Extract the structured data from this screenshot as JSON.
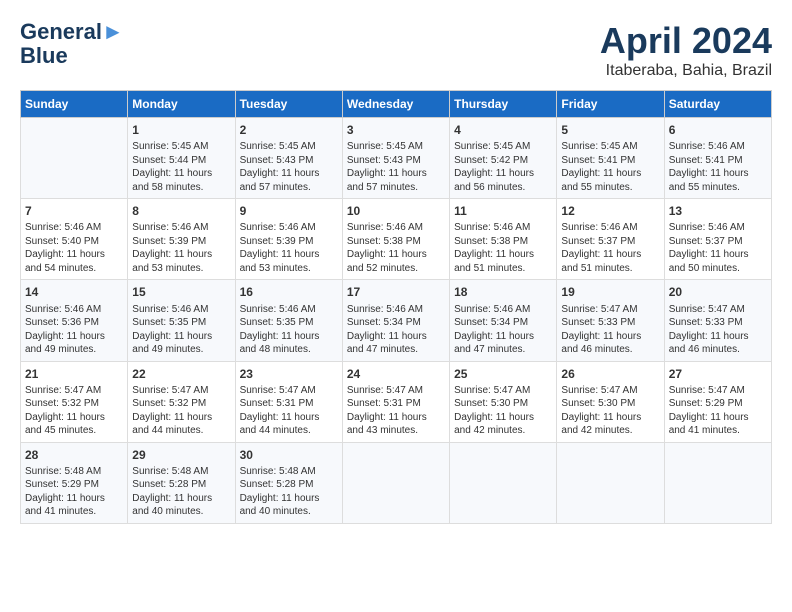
{
  "header": {
    "logo_line1": "General",
    "logo_line2": "Blue",
    "month_title": "April 2024",
    "location": "Itaberaba, Bahia, Brazil"
  },
  "calendar": {
    "days_of_week": [
      "Sunday",
      "Monday",
      "Tuesday",
      "Wednesday",
      "Thursday",
      "Friday",
      "Saturday"
    ],
    "weeks": [
      [
        {
          "day": "",
          "info": ""
        },
        {
          "day": "1",
          "info": "Sunrise: 5:45 AM\nSunset: 5:44 PM\nDaylight: 11 hours\nand 58 minutes."
        },
        {
          "day": "2",
          "info": "Sunrise: 5:45 AM\nSunset: 5:43 PM\nDaylight: 11 hours\nand 57 minutes."
        },
        {
          "day": "3",
          "info": "Sunrise: 5:45 AM\nSunset: 5:43 PM\nDaylight: 11 hours\nand 57 minutes."
        },
        {
          "day": "4",
          "info": "Sunrise: 5:45 AM\nSunset: 5:42 PM\nDaylight: 11 hours\nand 56 minutes."
        },
        {
          "day": "5",
          "info": "Sunrise: 5:45 AM\nSunset: 5:41 PM\nDaylight: 11 hours\nand 55 minutes."
        },
        {
          "day": "6",
          "info": "Sunrise: 5:46 AM\nSunset: 5:41 PM\nDaylight: 11 hours\nand 55 minutes."
        }
      ],
      [
        {
          "day": "7",
          "info": "Sunrise: 5:46 AM\nSunset: 5:40 PM\nDaylight: 11 hours\nand 54 minutes."
        },
        {
          "day": "8",
          "info": "Sunrise: 5:46 AM\nSunset: 5:39 PM\nDaylight: 11 hours\nand 53 minutes."
        },
        {
          "day": "9",
          "info": "Sunrise: 5:46 AM\nSunset: 5:39 PM\nDaylight: 11 hours\nand 53 minutes."
        },
        {
          "day": "10",
          "info": "Sunrise: 5:46 AM\nSunset: 5:38 PM\nDaylight: 11 hours\nand 52 minutes."
        },
        {
          "day": "11",
          "info": "Sunrise: 5:46 AM\nSunset: 5:38 PM\nDaylight: 11 hours\nand 51 minutes."
        },
        {
          "day": "12",
          "info": "Sunrise: 5:46 AM\nSunset: 5:37 PM\nDaylight: 11 hours\nand 51 minutes."
        },
        {
          "day": "13",
          "info": "Sunrise: 5:46 AM\nSunset: 5:37 PM\nDaylight: 11 hours\nand 50 minutes."
        }
      ],
      [
        {
          "day": "14",
          "info": "Sunrise: 5:46 AM\nSunset: 5:36 PM\nDaylight: 11 hours\nand 49 minutes."
        },
        {
          "day": "15",
          "info": "Sunrise: 5:46 AM\nSunset: 5:35 PM\nDaylight: 11 hours\nand 49 minutes."
        },
        {
          "day": "16",
          "info": "Sunrise: 5:46 AM\nSunset: 5:35 PM\nDaylight: 11 hours\nand 48 minutes."
        },
        {
          "day": "17",
          "info": "Sunrise: 5:46 AM\nSunset: 5:34 PM\nDaylight: 11 hours\nand 47 minutes."
        },
        {
          "day": "18",
          "info": "Sunrise: 5:46 AM\nSunset: 5:34 PM\nDaylight: 11 hours\nand 47 minutes."
        },
        {
          "day": "19",
          "info": "Sunrise: 5:47 AM\nSunset: 5:33 PM\nDaylight: 11 hours\nand 46 minutes."
        },
        {
          "day": "20",
          "info": "Sunrise: 5:47 AM\nSunset: 5:33 PM\nDaylight: 11 hours\nand 46 minutes."
        }
      ],
      [
        {
          "day": "21",
          "info": "Sunrise: 5:47 AM\nSunset: 5:32 PM\nDaylight: 11 hours\nand 45 minutes."
        },
        {
          "day": "22",
          "info": "Sunrise: 5:47 AM\nSunset: 5:32 PM\nDaylight: 11 hours\nand 44 minutes."
        },
        {
          "day": "23",
          "info": "Sunrise: 5:47 AM\nSunset: 5:31 PM\nDaylight: 11 hours\nand 44 minutes."
        },
        {
          "day": "24",
          "info": "Sunrise: 5:47 AM\nSunset: 5:31 PM\nDaylight: 11 hours\nand 43 minutes."
        },
        {
          "day": "25",
          "info": "Sunrise: 5:47 AM\nSunset: 5:30 PM\nDaylight: 11 hours\nand 42 minutes."
        },
        {
          "day": "26",
          "info": "Sunrise: 5:47 AM\nSunset: 5:30 PM\nDaylight: 11 hours\nand 42 minutes."
        },
        {
          "day": "27",
          "info": "Sunrise: 5:47 AM\nSunset: 5:29 PM\nDaylight: 11 hours\nand 41 minutes."
        }
      ],
      [
        {
          "day": "28",
          "info": "Sunrise: 5:48 AM\nSunset: 5:29 PM\nDaylight: 11 hours\nand 41 minutes."
        },
        {
          "day": "29",
          "info": "Sunrise: 5:48 AM\nSunset: 5:28 PM\nDaylight: 11 hours\nand 40 minutes."
        },
        {
          "day": "30",
          "info": "Sunrise: 5:48 AM\nSunset: 5:28 PM\nDaylight: 11 hours\nand 40 minutes."
        },
        {
          "day": "",
          "info": ""
        },
        {
          "day": "",
          "info": ""
        },
        {
          "day": "",
          "info": ""
        },
        {
          "day": "",
          "info": ""
        }
      ]
    ]
  }
}
